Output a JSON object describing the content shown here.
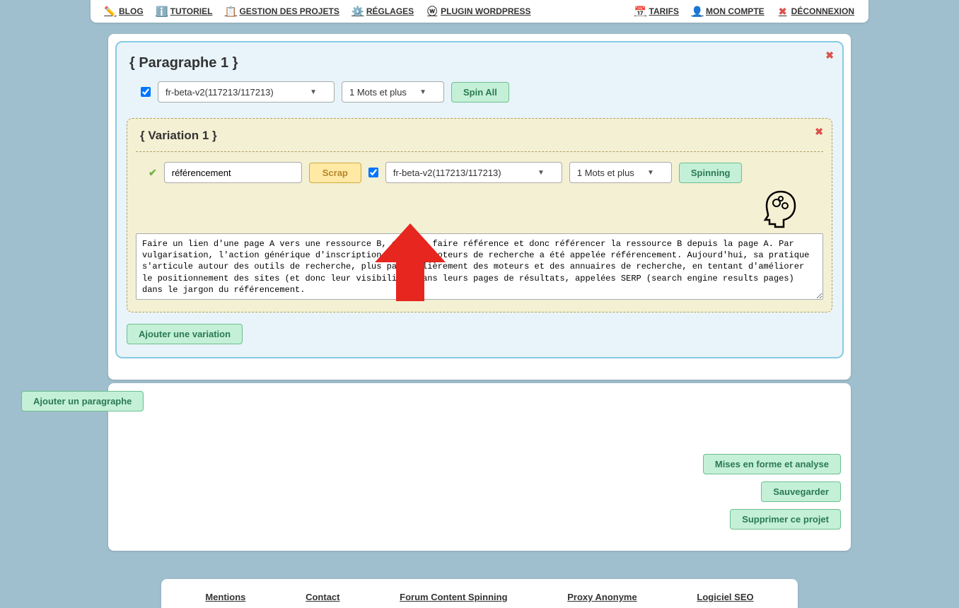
{
  "nav": {
    "left": [
      {
        "icon": "✏️",
        "label": "BLOG"
      },
      {
        "icon": "ℹ️",
        "label": "TUTORIEL"
      },
      {
        "icon": "📋",
        "label": "GESTION DES PROJETS"
      },
      {
        "icon": "⚙️",
        "label": "RÉGLAGES"
      },
      {
        "icon": "ⓦ",
        "label": "PLUGIN WORDPRESS"
      }
    ],
    "right": [
      {
        "icon": "📅",
        "label": "TARIFS"
      },
      {
        "icon": "👤",
        "label": "MON COMPTE"
      },
      {
        "icon": "✖",
        "label": "DÉCONNEXION"
      }
    ]
  },
  "paragraph": {
    "title": "{ Paragraphe 1 }",
    "select_dict": "fr-beta-v2(117213/117213)",
    "select_words": "1 Mots et plus",
    "spin_all": "Spin All"
  },
  "variation": {
    "title": "{ Variation 1 }",
    "keyword": "référencement",
    "scrap": "Scrap",
    "select_dict": "fr-beta-v2(117213/117213)",
    "select_words": "1 Mots et plus",
    "spinning": "Spinning",
    "text": "Faire un lien d'une page A vers une ressource B, c'est y faire référence et donc référencer la ressource B depuis la page A. Par vulgarisation, l'action générique d'inscription dans les moteurs de recherche a été appelée référencement. Aujourd'hui, sa pratique s'articule autour des outils de recherche, plus particulièrement des moteurs et des annuaires de recherche, en tentant d'améliorer le positionnement des sites (et donc leur visibilité) dans leurs pages de résultats, appelées SERP (search engine results pages) dans le jargon du référencement."
  },
  "buttons": {
    "add_variation": "Ajouter une variation",
    "add_paragraph": "Ajouter un paragraphe",
    "format_analyse": "Mises en forme et analyse",
    "save": "Sauvegarder",
    "delete": "Supprimer ce projet"
  },
  "footer": {
    "mentions": "Mentions",
    "contact": "Contact",
    "forum": "Forum Content Spinning",
    "proxy": "Proxy Anonyme",
    "seo": "Logiciel SEO"
  }
}
